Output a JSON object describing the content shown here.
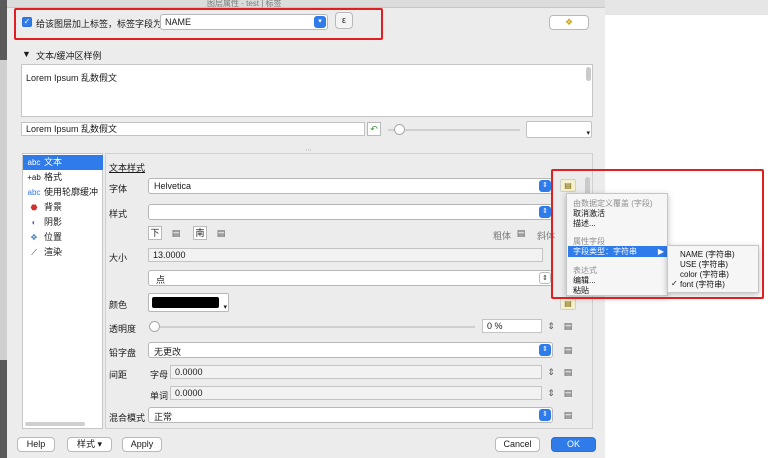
{
  "window": {
    "title": "图层属性 - test | 标签"
  },
  "header": {
    "checkbox_label": "给该图层加上标签，标签字段为",
    "field_value": "NAME",
    "expression_button": "ε",
    "checked": true
  },
  "sample": {
    "section_title": "文本/缓冲区样例",
    "preview_text": "Lorem Ipsum 乱数假文",
    "input_value": "Lorem Ipsum 乱数假文"
  },
  "sidebar": {
    "items": [
      {
        "label": "文本",
        "icon": "abc-icon"
      },
      {
        "label": "格式",
        "icon": "format-icon"
      },
      {
        "label": "使用轮廓缓冲",
        "icon": "buffer-icon"
      },
      {
        "label": "背景",
        "icon": "background-icon"
      },
      {
        "label": "阴影",
        "icon": "shadow-icon"
      },
      {
        "label": "位置",
        "icon": "placement-icon"
      },
      {
        "label": "渲染",
        "icon": "rendering-icon"
      }
    ]
  },
  "text_style": {
    "title": "文本样式",
    "font_label": "字体",
    "font_value": "Helvetica",
    "style_label": "样式",
    "style_value": "",
    "underline": "下",
    "strikeout": "南",
    "bold": "粗体",
    "italic": "斜体",
    "size_label": "大小",
    "size_value": "13.0000",
    "unit_value": "点",
    "color_label": "颜色",
    "color_hex": "#000000",
    "opacity_label": "透明度",
    "opacity_value": "0 %",
    "opacity_level": 0,
    "case_label": "铅字盘",
    "case_value": "无更改",
    "spacing_label": "间距",
    "letter_label": "字母",
    "letter_value": "0.0000",
    "word_label": "单词",
    "word_value": "0.0000",
    "blend_label": "混合模式",
    "blend_value": "正常"
  },
  "context_menu": {
    "section1": "由数据定义覆盖 (字段)",
    "deactivate": "取消激活",
    "describe": "描述...",
    "section2": "属性字段",
    "field_type": "字段类型：字符串",
    "section3": "表达式",
    "edit": "编辑...",
    "paste": "粘贴"
  },
  "submenu": {
    "items": [
      {
        "label": "NAME   (字符串)",
        "checked": false
      },
      {
        "label": "USE   (字符串)",
        "checked": false
      },
      {
        "label": "color   (字符串)",
        "checked": false
      },
      {
        "label": "font   (字符串)",
        "checked": true
      }
    ],
    "check_mark": "✓"
  },
  "footer": {
    "help": "Help",
    "style": "样式",
    "apply": "Apply",
    "cancel": "Cancel",
    "ok": "OK"
  },
  "colors": {
    "accent": "#2f7be9",
    "highlight_box": "#e02020"
  }
}
